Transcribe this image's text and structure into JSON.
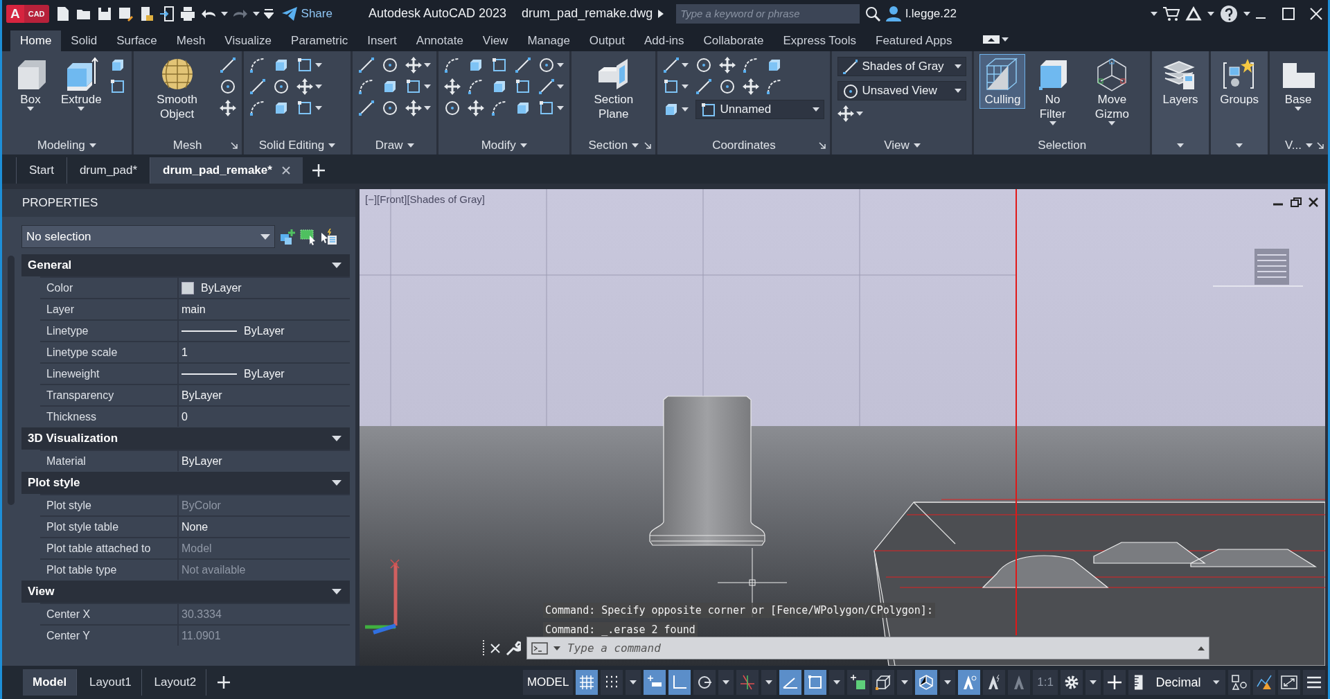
{
  "title_bar": {
    "app_letter": "A",
    "app_badge": "CAD",
    "share": "Share",
    "app_title": "Autodesk AutoCAD 2023",
    "file_name": "drum_pad_remake.dwg",
    "search": {
      "placeholder": "Type a keyword or phrase"
    },
    "user": "l.legge.22"
  },
  "ribbon_tabs": [
    {
      "label": "Home",
      "selected": true
    },
    {
      "label": "Solid",
      "selected": false
    },
    {
      "label": "Surface",
      "selected": false
    },
    {
      "label": "Mesh",
      "selected": false
    },
    {
      "label": "Visualize",
      "selected": false
    },
    {
      "label": "Parametric",
      "selected": false
    },
    {
      "label": "Insert",
      "selected": false
    },
    {
      "label": "Annotate",
      "selected": false
    },
    {
      "label": "View",
      "selected": false
    },
    {
      "label": "Manage",
      "selected": false
    },
    {
      "label": "Output",
      "selected": false
    },
    {
      "label": "Add-ins",
      "selected": false
    },
    {
      "label": "Collaborate",
      "selected": false
    },
    {
      "label": "Express Tools",
      "selected": false
    },
    {
      "label": "Featured Apps",
      "selected": false
    }
  ],
  "ribbon_panels": [
    {
      "title": "Modeling",
      "menu": true,
      "launcher": false,
      "large_tools": [
        {
          "label": "Box",
          "menu": true,
          "on": false
        },
        {
          "label": "Extrude",
          "menu": true,
          "on": false
        }
      ]
    },
    {
      "title": "Mesh",
      "menu": false,
      "launcher": true,
      "large_tools": [
        {
          "label": "Smooth Object",
          "menu": false,
          "on": false
        }
      ]
    },
    {
      "title": "Solid Editing",
      "menu": true,
      "launcher": false
    },
    {
      "title": "Draw",
      "menu": true,
      "launcher": false
    },
    {
      "title": "Modify",
      "menu": true,
      "launcher": false
    },
    {
      "title": "Section",
      "menu": true,
      "launcher": true,
      "large_tools": [
        {
          "label": "Section Plane",
          "menu": false,
          "on": false
        }
      ]
    },
    {
      "title": "Coordinates",
      "menu": false,
      "launcher": true,
      "dropdowns": [
        "Unnamed"
      ]
    },
    {
      "title": "View",
      "menu": true,
      "launcher": false,
      "dropdowns": [
        "Shades of Gray",
        "Unsaved View"
      ]
    },
    {
      "title": "Selection",
      "menu": false,
      "launcher": false,
      "large_tools": [
        {
          "label": "Culling",
          "menu": false,
          "on": true
        },
        {
          "label": "No Filter",
          "menu": true,
          "on": false
        },
        {
          "label": "Move Gizmo",
          "menu": true,
          "on": false
        }
      ]
    },
    {
      "menu": true,
      "launcher": false,
      "large_tools": [
        {
          "label": "Layers",
          "menu": false,
          "on": false
        }
      ]
    },
    {
      "menu": true,
      "launcher": false,
      "large_tools": [
        {
          "label": "Groups",
          "menu": false,
          "on": false
        }
      ]
    },
    {
      "title": "V...",
      "menu": true,
      "launcher": true,
      "large_tools": [
        {
          "label": "Base",
          "menu": true,
          "on": false
        }
      ]
    }
  ],
  "document_tabs": [
    {
      "label": "Start",
      "selected": false
    },
    {
      "label": "drum_pad*",
      "selected": false
    },
    {
      "label": "drum_pad_remake*",
      "selected": true
    }
  ],
  "properties": {
    "title": "PROPERTIES",
    "selection": "No selection",
    "sections": [
      {
        "title": "General",
        "expanded": true,
        "rows": [
          {
            "label": "Color",
            "value": "ByLayer",
            "kind": "swatch",
            "disabled": false
          },
          {
            "label": "Layer",
            "value": "main",
            "kind": "text",
            "disabled": false
          },
          {
            "label": "Linetype",
            "value": "ByLayer",
            "kind": "line",
            "disabled": false
          },
          {
            "label": "Linetype scale",
            "value": "1",
            "kind": "text",
            "disabled": false
          },
          {
            "label": "Lineweight",
            "value": "ByLayer",
            "kind": "line",
            "disabled": false
          },
          {
            "label": "Transparency",
            "value": "ByLayer",
            "kind": "text",
            "disabled": false
          },
          {
            "label": "Thickness",
            "value": "0",
            "kind": "text",
            "disabled": false
          }
        ]
      },
      {
        "title": "3D Visualization",
        "expanded": true,
        "rows": [
          {
            "label": "Material",
            "value": "ByLayer",
            "kind": "text",
            "disabled": false
          }
        ]
      },
      {
        "title": "Plot style",
        "expanded": true,
        "rows": [
          {
            "label": "Plot style",
            "value": "ByColor",
            "kind": "text",
            "disabled": true
          },
          {
            "label": "Plot style table",
            "value": "None",
            "kind": "text",
            "disabled": false
          },
          {
            "label": "Plot table attached to",
            "value": "Model",
            "kind": "text",
            "disabled": true
          },
          {
            "label": "Plot table type",
            "value": "Not available",
            "kind": "text",
            "disabled": true
          }
        ]
      },
      {
        "title": "View",
        "expanded": true,
        "rows": [
          {
            "label": "Center X",
            "value": "30.3334",
            "kind": "text",
            "disabled": true
          },
          {
            "label": "Center Y",
            "value": "11.0901",
            "kind": "text",
            "disabled": true
          }
        ]
      }
    ]
  },
  "viewport": {
    "label": "[−][Front][Shades of Gray]",
    "command_history": [
      "Command: Specify opposite corner or [Fence/WPolygon/CPolygon]:",
      "Command: _.erase 2 found"
    ],
    "command_line": {
      "placeholder": "Type a command"
    }
  },
  "layout_tabs": [
    {
      "label": "Model",
      "selected": true
    },
    {
      "label": "Layout1",
      "selected": false
    },
    {
      "label": "Layout2",
      "selected": false
    }
  ],
  "status_bar": {
    "space": "MODEL",
    "tools": [
      {
        "kind": "toggle",
        "on": true
      },
      {
        "kind": "toggle",
        "on": false
      },
      {
        "kind": "caret"
      },
      {
        "kind": "toggle",
        "on": true
      },
      {
        "kind": "toggle",
        "on": true
      },
      {
        "kind": "toggle",
        "on": false
      },
      {
        "kind": "caret"
      },
      {
        "kind": "toggle",
        "on": false
      },
      {
        "kind": "caret"
      },
      {
        "kind": "toggle",
        "on": true
      },
      {
        "kind": "toggle",
        "on": true
      },
      {
        "kind": "caret"
      },
      {
        "kind": "toggle",
        "on": false
      },
      {
        "kind": "toggle",
        "on": false
      },
      {
        "kind": "caret"
      },
      {
        "kind": "toggle",
        "on": true
      },
      {
        "kind": "caret"
      },
      {
        "kind": "toggle",
        "on": true
      },
      {
        "kind": "toggle",
        "on": false
      },
      {
        "kind": "toggle",
        "on": false
      },
      {
        "kind": "text",
        "label": "1:1"
      },
      {
        "kind": "toggle",
        "on": false
      },
      {
        "kind": "caret"
      },
      {
        "kind": "toggle",
        "on": false
      },
      {
        "kind": "units",
        "label": "Decimal"
      },
      {
        "kind": "toggle",
        "on": false
      },
      {
        "kind": "toggle",
        "on": false
      },
      {
        "kind": "toggle",
        "on": false
      },
      {
        "kind": "toggle",
        "on": false
      }
    ]
  }
}
